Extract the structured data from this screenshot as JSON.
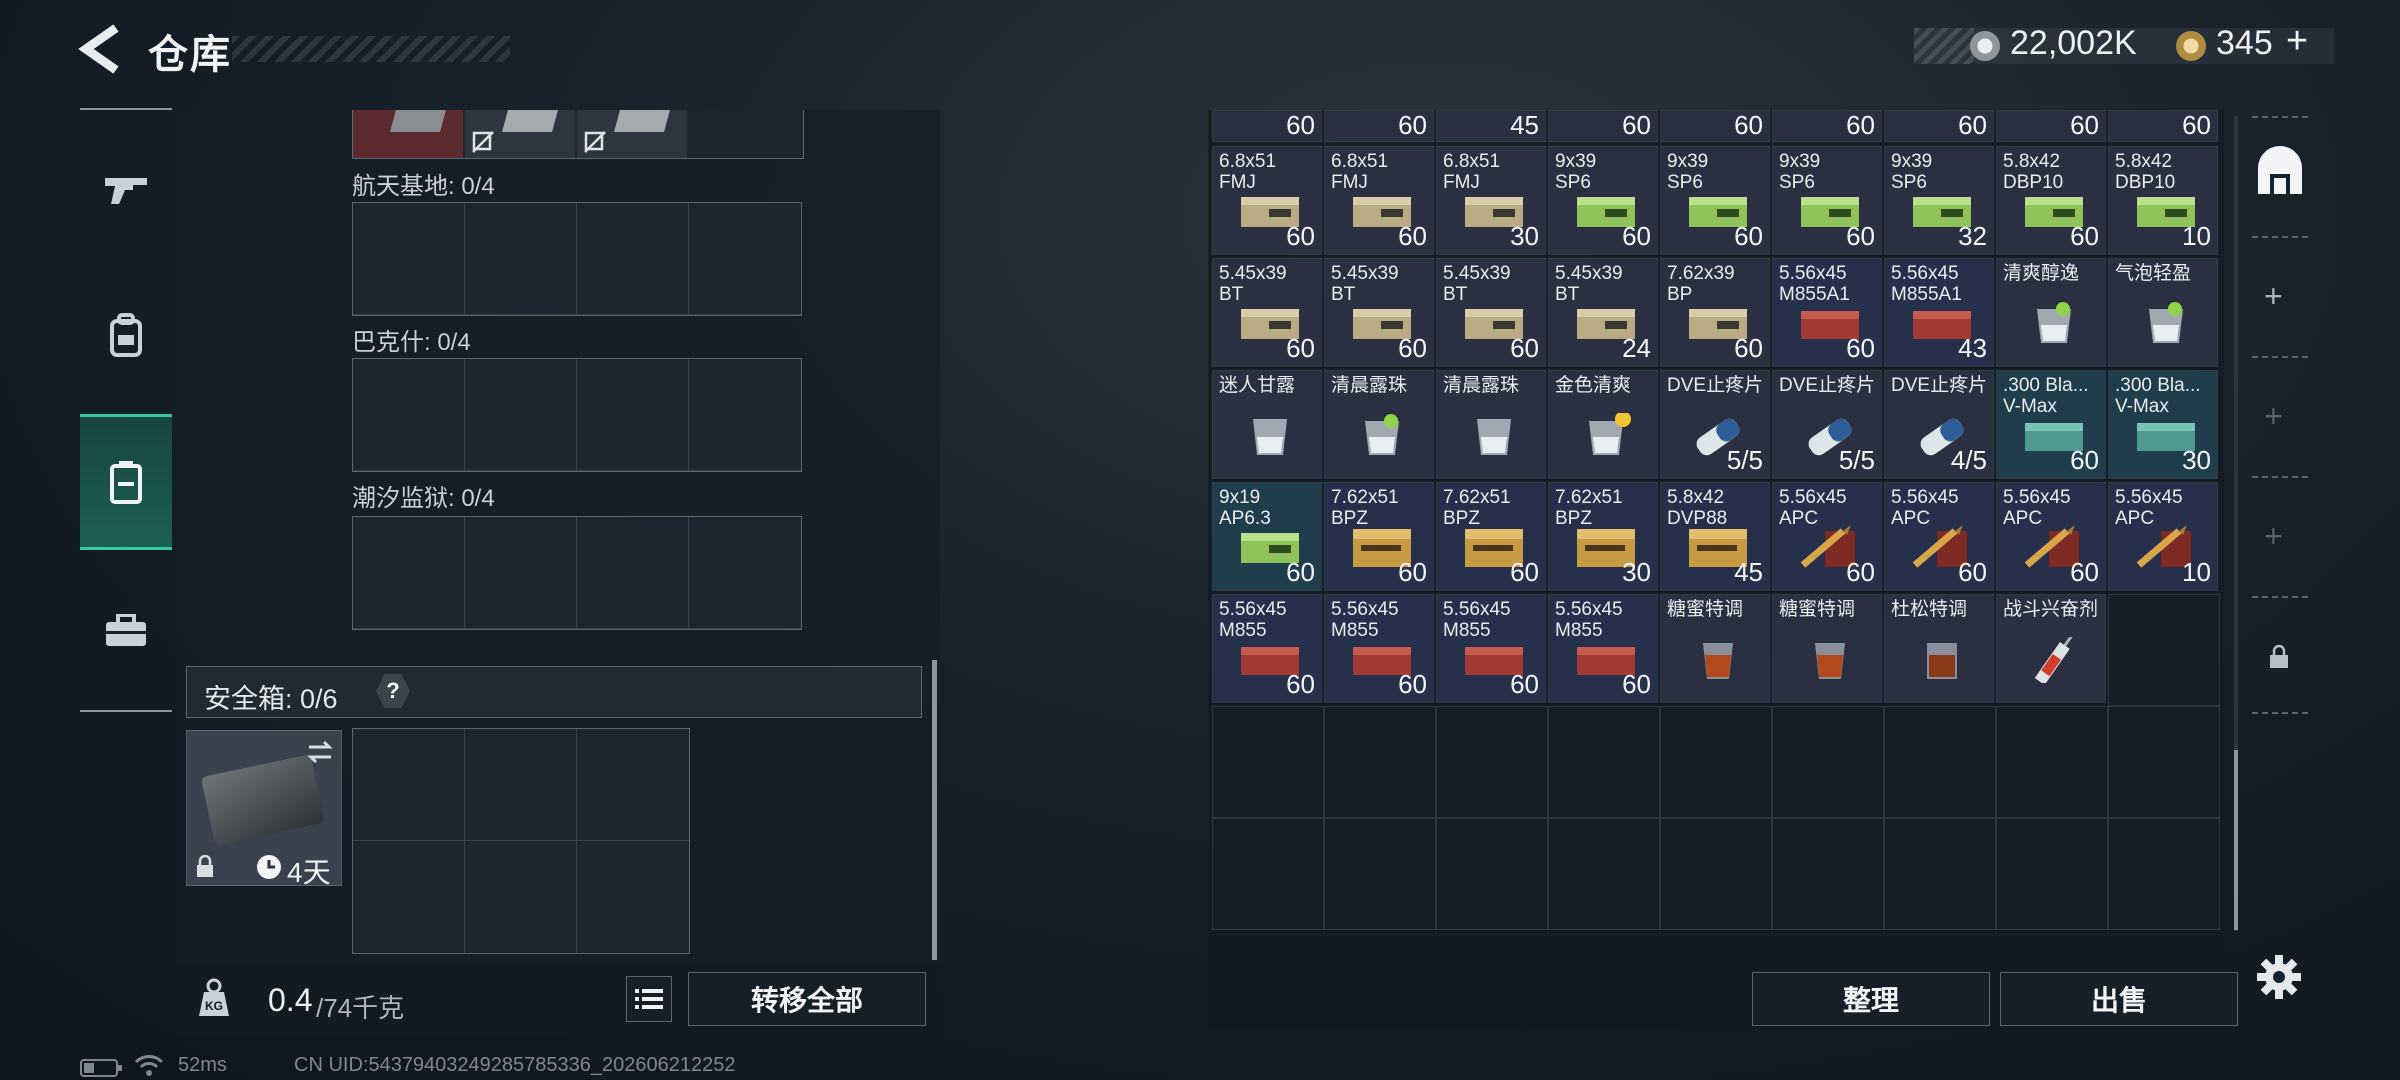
{
  "header": {
    "title": "仓库",
    "currency_primary": "22,002K",
    "currency_secondary": "345",
    "plus": "+"
  },
  "left": {
    "sections": [
      {
        "label": "航天基地: 0/4"
      },
      {
        "label": "巴克什: 0/4"
      },
      {
        "label": "潮汐监狱: 0/4"
      }
    ],
    "safe_box_label": "安全箱: 0/6",
    "safe_box_help": "?",
    "safe_box_timer": "4天",
    "weight_value": "0.4",
    "weight_total": "/74千克",
    "transfer_all": "转移全部"
  },
  "inventory": {
    "top_partial_counts": [
      "60",
      "60",
      "45",
      "60",
      "60",
      "60",
      "60",
      "60",
      "60"
    ],
    "rows": [
      [
        {
          "name": "6.8x51\nFMJ",
          "count": "60",
          "kind": "ammo-tan"
        },
        {
          "name": "6.8x51\nFMJ",
          "count": "60",
          "kind": "ammo-tan"
        },
        {
          "name": "6.8x51\nFMJ",
          "count": "30",
          "kind": "ammo-tan"
        },
        {
          "name": "9x39\nSP6",
          "count": "60",
          "kind": "ammo-green"
        },
        {
          "name": "9x39\nSP6",
          "count": "60",
          "kind": "ammo-green"
        },
        {
          "name": "9x39\nSP6",
          "count": "60",
          "kind": "ammo-green"
        },
        {
          "name": "9x39\nSP6",
          "count": "32",
          "kind": "ammo-green"
        },
        {
          "name": "5.8x42\nDBP10",
          "count": "60",
          "kind": "ammo-green"
        },
        {
          "name": "5.8x42\nDBP10",
          "count": "10",
          "kind": "ammo-green"
        }
      ],
      [
        {
          "name": "5.45x39\nBT",
          "count": "60",
          "kind": "ammo-tan"
        },
        {
          "name": "5.45x39\nBT",
          "count": "60",
          "kind": "ammo-tan"
        },
        {
          "name": "5.45x39\nBT",
          "count": "60",
          "kind": "ammo-tan"
        },
        {
          "name": "5.45x39\nBT",
          "count": "24",
          "kind": "ammo-tan"
        },
        {
          "name": "7.62x39\nBP",
          "count": "60",
          "kind": "ammo-tan"
        },
        {
          "name": "5.56x45\nM855A1",
          "count": "60",
          "kind": "ammo-red"
        },
        {
          "name": "5.56x45\nM855A1",
          "count": "43",
          "kind": "ammo-red"
        },
        {
          "name": "清爽醇逸",
          "count": "",
          "kind": "glass-lime"
        },
        {
          "name": "气泡轻盈",
          "count": "",
          "kind": "glass-lime"
        }
      ],
      [
        {
          "name": "迷人甘露",
          "count": "",
          "kind": "glass"
        },
        {
          "name": "清晨露珠",
          "count": "",
          "kind": "glass-lime"
        },
        {
          "name": "清晨露珠",
          "count": "",
          "kind": "glass"
        },
        {
          "name": "金色清爽",
          "count": "",
          "kind": "glass-lemon"
        },
        {
          "name": "DVE止疼片",
          "count": "5/5",
          "kind": "pill"
        },
        {
          "name": "DVE止疼片",
          "count": "5/5",
          "kind": "pill"
        },
        {
          "name": "DVE止疼片",
          "count": "4/5",
          "kind": "pill"
        },
        {
          "name": ".300 Bla...\nV-Max",
          "count": "60",
          "kind": "ammo-teal"
        },
        {
          "name": ".300 Bla...\nV-Max",
          "count": "30",
          "kind": "ammo-teal"
        }
      ],
      [
        {
          "name": "9x19\nAP6.3",
          "count": "60",
          "kind": "ammo-green"
        },
        {
          "name": "7.62x51\nBPZ",
          "count": "60",
          "kind": "ammo-box"
        },
        {
          "name": "7.62x51\nBPZ",
          "count": "60",
          "kind": "ammo-box"
        },
        {
          "name": "7.62x51\nBPZ",
          "count": "30",
          "kind": "ammo-box"
        },
        {
          "name": "5.8x42\nDVP88",
          "count": "45",
          "kind": "ammo-box"
        },
        {
          "name": "5.56x45\nAPC",
          "count": "60",
          "kind": "ammo-bullet"
        },
        {
          "name": "5.56x45\nAPC",
          "count": "60",
          "kind": "ammo-bullet"
        },
        {
          "name": "5.56x45\nAPC",
          "count": "60",
          "kind": "ammo-bullet"
        },
        {
          "name": "5.56x45\nAPC",
          "count": "10",
          "kind": "ammo-bullet"
        }
      ],
      [
        {
          "name": "5.56x45\nM855",
          "count": "60",
          "kind": "ammo-red"
        },
        {
          "name": "5.56x45\nM855",
          "count": "60",
          "kind": "ammo-red"
        },
        {
          "name": "5.56x45\nM855",
          "count": "60",
          "kind": "ammo-red"
        },
        {
          "name": "5.56x45\nM855",
          "count": "60",
          "kind": "ammo-red"
        },
        {
          "name": "糖蜜特调",
          "count": "",
          "kind": "whiskey"
        },
        {
          "name": "糖蜜特调",
          "count": "",
          "kind": "whiskey"
        },
        {
          "name": "杜松特调",
          "count": "",
          "kind": "whiskey-dark"
        },
        {
          "name": "战斗兴奋剂",
          "count": "",
          "kind": "syringe"
        }
      ]
    ],
    "sort_button": "整理",
    "sell_button": "出售"
  },
  "status": {
    "ping": "52ms",
    "uid": "CN UID:5437940324928578533​6_202606212252"
  },
  "colors": {
    "accent": "#35c6a3",
    "cell_bg": "#272d3e",
    "cell_teal": "#1f3d4a"
  }
}
